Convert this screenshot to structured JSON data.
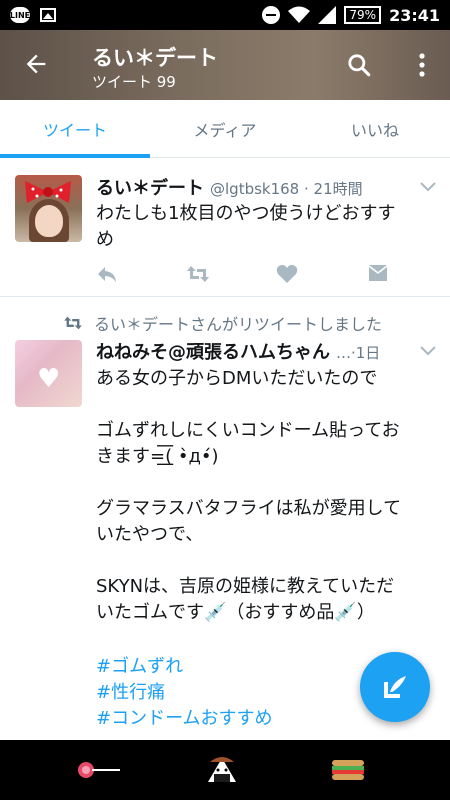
{
  "status_bar": {
    "line_icon": "LINE",
    "battery": "79%",
    "time": "23:41"
  },
  "header": {
    "title": "るい＊デート",
    "subtitle": "ツイート 99"
  },
  "tabs": [
    {
      "label": "ツイート",
      "active": true
    },
    {
      "label": "メディア",
      "active": false
    },
    {
      "label": "いいね",
      "active": false
    }
  ],
  "tweets": [
    {
      "name": "るい＊デート",
      "handle": "@lgtbsk168 · 21時間",
      "lines": [
        "わたしも1枚目のやつ使うけどおすす",
        "め"
      ]
    },
    {
      "retweet_note": "るい＊デートさんがリツイートしました",
      "name": "ねねみそ@頑張るハムちゃん",
      "handle": "…·1日",
      "lines": [
        "ある女の子からDMいただいたので",
        "",
        "ゴムずれしにくいコンドーム貼ってお",
        "きます=͟͟͞͞( •̀д•́)",
        "",
        "グラマラスバタフライは私が愛用して",
        "いたやつで、",
        "",
        "SKYNは、吉原の姫様に教えていただ",
        "いたゴムです💉（おすすめ品💉）"
      ],
      "hashtags": [
        "#ゴムずれ",
        "#性行痛",
        "#コンドームおすすめ"
      ]
    }
  ],
  "colors": {
    "accent": "#1da1f2",
    "secondary_text": "#657786",
    "divider": "#e1e8ed"
  }
}
